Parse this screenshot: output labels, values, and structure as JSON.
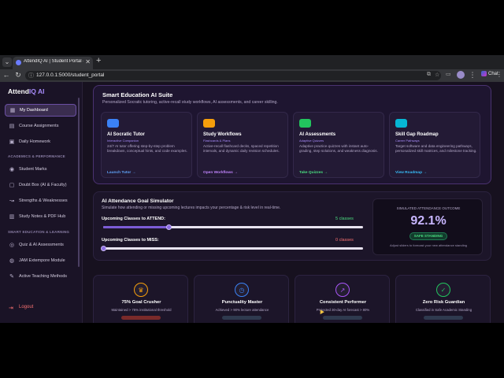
{
  "browser": {
    "tab_title": "AttendIQ AI | Student Portal - IOH",
    "tab_close": "✕",
    "new_tab": "+",
    "url": "127.0.0.1:5000/student_portal",
    "chat_label": "Chat"
  },
  "sidebar": {
    "brand_main": "Attend",
    "brand_accent": "IQ AI",
    "items_top": [
      {
        "label": "My Dashboard",
        "icon": "dashboard-icon",
        "active": true
      },
      {
        "label": "Course Assignments",
        "icon": "file-icon"
      },
      {
        "label": "Daily Homework",
        "icon": "calendar-icon"
      }
    ],
    "section_academics": "ACADEMICS & PERFORMANCE",
    "items_academics": [
      {
        "label": "Student Marks",
        "icon": "user-icon"
      },
      {
        "label": "Doubt Box (AI & Faculty)",
        "icon": "chat-icon"
      },
      {
        "label": "Strengths & Weaknesses",
        "icon": "chart-icon"
      },
      {
        "label": "Study Notes & PDF Hub",
        "icon": "notes-icon"
      }
    ],
    "section_smart": "SMART EDUCATION & LEARNING",
    "items_smart": [
      {
        "label": "Quiz & AI Assessments",
        "icon": "quiz-icon"
      },
      {
        "label": "JAM Extempore Module",
        "icon": "mic-icon"
      },
      {
        "label": "Active Teaching Methods",
        "icon": "teaching-icon"
      }
    ],
    "logout": "Logout"
  },
  "suite": {
    "title": "Smart Education AI Suite",
    "subtitle": "Personalized Socratic tutoring, active-recall study workflows, AI assessments, and career skilling.",
    "tools": [
      {
        "name": "AI Socratic Tutor",
        "tag": "Interactive Companion",
        "desc": "24/7 AI tutor offering step-by-step problem breakdown, conceptual hints, and code examples.",
        "link": "Launch Tutor →",
        "color": "#3b82f6",
        "link_color": "#60a5fa"
      },
      {
        "name": "Study Workflows",
        "tag": "Flashcards & Plans",
        "desc": "Active-recall flashcard decks, spaced repetition intervals, and dynamic daily revision schedules.",
        "link": "Open Workflows →",
        "color": "#f59e0b",
        "link_color": "#c084fc"
      },
      {
        "name": "AI Assessments",
        "tag": "Adaptive Quizzes",
        "desc": "Adaptive practice quizzes with instant auto-grading, step solutions, and weakness diagnosis.",
        "link": "Take Quizzes →",
        "color": "#22c55e",
        "link_color": "#4ade80"
      },
      {
        "name": "Skill Gap Roadmap",
        "tag": "Career Pathways",
        "desc": "Target software and data engineering pathways, personalized skill matrices, and milestone tracking.",
        "link": "View Roadmap →",
        "color": "#06b6d4",
        "link_color": "#38bdf8"
      }
    ]
  },
  "simulator": {
    "title": "AI Attendance Goal Simulator",
    "subtitle": "Simulate how attending or missing upcoming lectures impacts your percentage & risk level in real-time.",
    "attend_label": "Upcoming Classes to ATTEND:",
    "attend_value": "5 classes",
    "attend_fraction": 0.25,
    "miss_label": "Upcoming Classes to MISS:",
    "miss_value": "0 classes",
    "miss_fraction": 0.0,
    "outcome_title": "SIMULATED ATTENDANCE OUTCOME",
    "outcome_pct": "92.1%",
    "outcome_badge": "SAFE STANDING",
    "outcome_note": "Adjust sliders to forecast your new attendance standing"
  },
  "achievements": [
    {
      "name": "75% Goal Crusher",
      "desc": "Maintained > 75% institutional threshold",
      "icon": "medal-icon",
      "glyph": "♛",
      "color": "#f59e0b",
      "bar": "#7a2a2a"
    },
    {
      "name": "Punctuality Master",
      "desc": "Achieved > 90% lecture attendance",
      "icon": "clock-icon",
      "glyph": "◷",
      "color": "#3b82f6",
      "bar": "#2f3a4f"
    },
    {
      "name": "Consistent Performer",
      "desc": "Projected 30-day AI forecast > 80%",
      "icon": "trend-icon",
      "glyph": "↗",
      "color": "#a855f7",
      "bar": "#2f3a4f"
    },
    {
      "name": "Zero Risk Guardian",
      "desc": "Classified in Safe Academic Standing",
      "icon": "shield-icon",
      "glyph": "✓",
      "color": "#22c55e",
      "bar": "#2f3a4f"
    }
  ]
}
